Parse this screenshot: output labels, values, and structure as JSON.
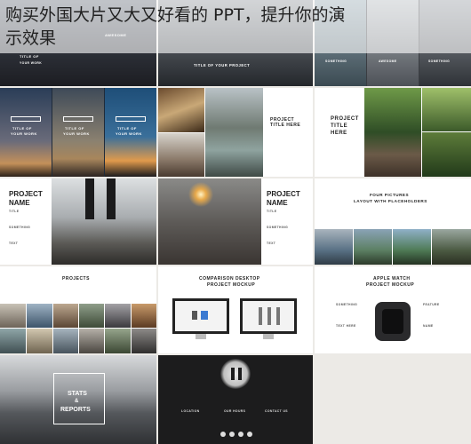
{
  "overlay": {
    "line1": "购买外国大片又大又好看的 PPT，提升你的演",
    "line2": "示效果"
  },
  "slides": {
    "s1": {
      "t1": "TITLE OF",
      "t2": "YOUR WORK",
      "t3": "AWESOME"
    },
    "s2": {
      "title": "TITLE OF YOUR PROJECT"
    },
    "s3": {
      "t1": "SOMETHING",
      "t2": "AWESOME",
      "t3": "SOMETHING"
    },
    "s4": {
      "a": "TITLE OF",
      "b": "YOUR WORK"
    },
    "s5": {
      "t1": "PROJECT",
      "t2": "TITLE HERE"
    },
    "s6": {
      "t1": "PROJECT",
      "t2": "TITLE",
      "t3": "HERE"
    },
    "s7": {
      "t1": "PROJECT",
      "t2": "NAME",
      "t3": "TITLE",
      "t4": "SOMETHING",
      "t5": "TEXT"
    },
    "s8": {
      "t1": "PROJECT",
      "t2": "NAME",
      "t3": "TITLE",
      "t4": "SOMETHING",
      "t5": "TEXT"
    },
    "s9": {
      "t1": "FOUR PICTURES",
      "t2": "LAYOUT WITH PLACEHOLDERS"
    },
    "s10": {
      "t1": "PROJECTS"
    },
    "s11": {
      "t1": "COMPARISON DESKTOP",
      "t2": "PROJECT MOCKUP"
    },
    "s12": {
      "t1": "APPLE WATCH",
      "t2": "PROJECT MOCKUP",
      "a": "SOMETHING",
      "b": "FEATURE",
      "c": "TEXT HERE",
      "d": "NAME"
    },
    "s13": {
      "t1": "STATS",
      "t2": "&",
      "t3": "REPORTS"
    },
    "s14": {
      "a": "LOCATION",
      "b": "OUR HOURS",
      "c": "CONTACT US"
    }
  },
  "colors": {
    "bg": "#eceae6",
    "dark": "#222222"
  }
}
